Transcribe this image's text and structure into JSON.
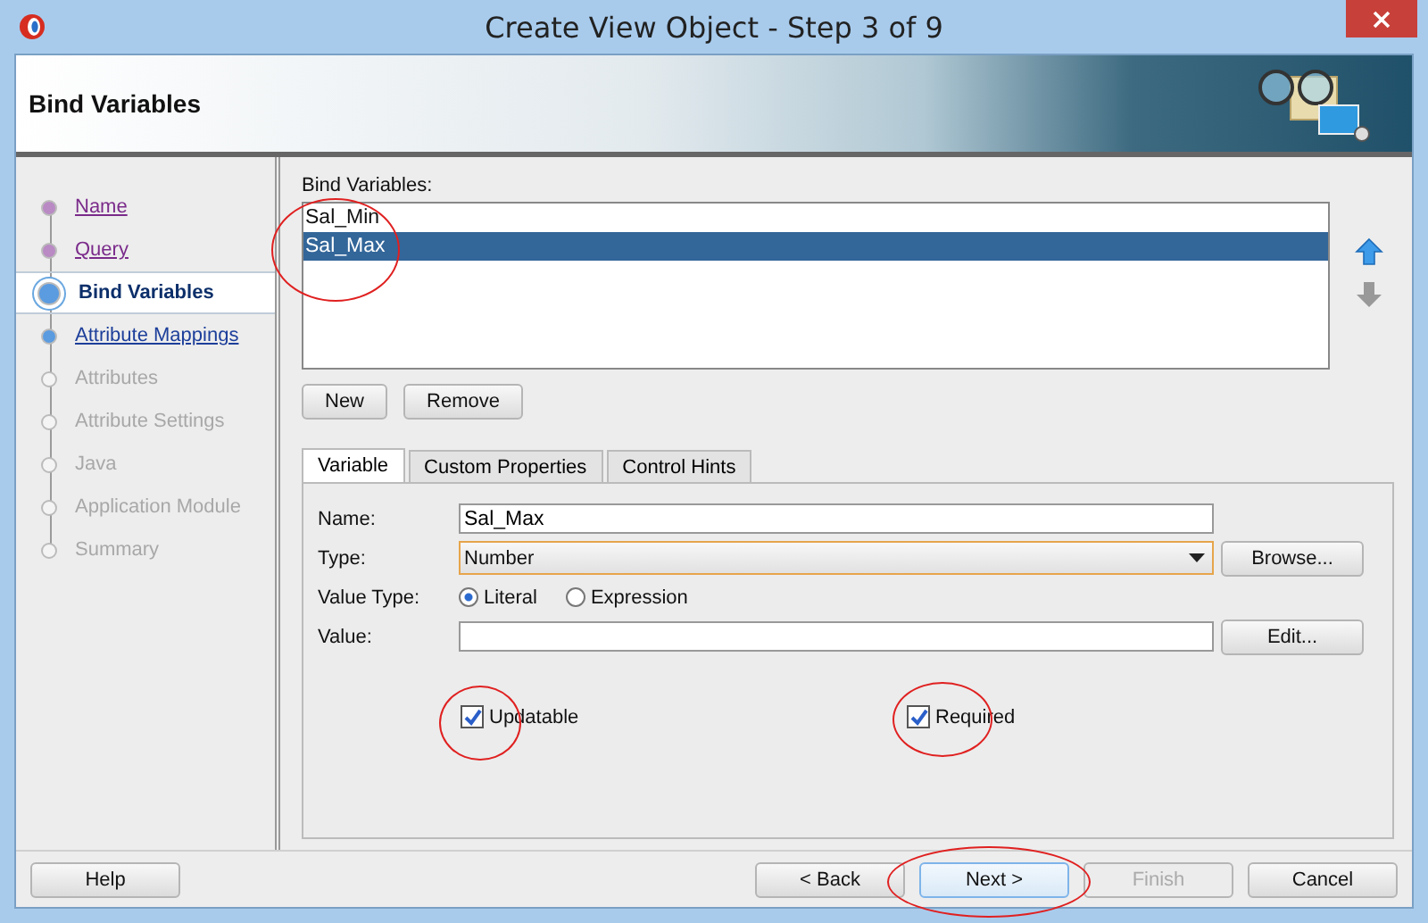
{
  "window": {
    "title": "Create View Object - Step 3 of 9"
  },
  "header": {
    "title": "Bind Variables"
  },
  "steps": [
    {
      "label": "Name",
      "visited": true,
      "disabled": false,
      "selected": false
    },
    {
      "label": "Query",
      "visited": true,
      "disabled": false,
      "selected": false
    },
    {
      "label": "Bind Variables",
      "visited": false,
      "disabled": false,
      "selected": true
    },
    {
      "label": "Attribute Mappings",
      "visited": false,
      "disabled": false,
      "selected": false
    },
    {
      "label": "Attributes",
      "visited": false,
      "disabled": true,
      "selected": false
    },
    {
      "label": "Attribute Settings",
      "visited": false,
      "disabled": true,
      "selected": false
    },
    {
      "label": "Java",
      "visited": false,
      "disabled": true,
      "selected": false
    },
    {
      "label": "Application Module",
      "visited": false,
      "disabled": true,
      "selected": false
    },
    {
      "label": "Summary",
      "visited": false,
      "disabled": true,
      "selected": false
    }
  ],
  "bind_variables": {
    "label": "Bind Variables:",
    "items": [
      {
        "label": "Sal_Min",
        "selected": false
      },
      {
        "label": "Sal_Max",
        "selected": true
      }
    ],
    "move_up_disabled": false,
    "move_down_disabled": true
  },
  "list_buttons": [
    "New",
    "Remove"
  ],
  "tabs": [
    {
      "label": "Variable",
      "selected": true
    },
    {
      "label": "Custom Properties",
      "selected": false
    },
    {
      "label": "Control Hints",
      "selected": false
    }
  ],
  "form": {
    "name_label": "Name:",
    "name_value": "Sal_Max",
    "type_label": "Type:",
    "type_value": "Number",
    "browse_button": "Browse...",
    "value_type_label": "Value Type:",
    "value_types": [
      {
        "label": "Literal",
        "selected": true
      },
      {
        "label": "Expression",
        "selected": false
      }
    ],
    "value_label": "Value:",
    "edit_button": "Edit...",
    "checkboxes": [
      {
        "label": "Updatable",
        "checked": true
      },
      {
        "label": "Required",
        "checked": true
      }
    ]
  },
  "footer": {
    "buttons": [
      {
        "label": "Help",
        "disabled": false,
        "default": false
      },
      {
        "label": "< Back",
        "disabled": false,
        "default": false
      },
      {
        "label": "Next >",
        "disabled": false,
        "default": true
      },
      {
        "label": "Finish",
        "disabled": true,
        "default": false
      },
      {
        "label": "Cancel",
        "disabled": false,
        "default": false
      }
    ]
  }
}
